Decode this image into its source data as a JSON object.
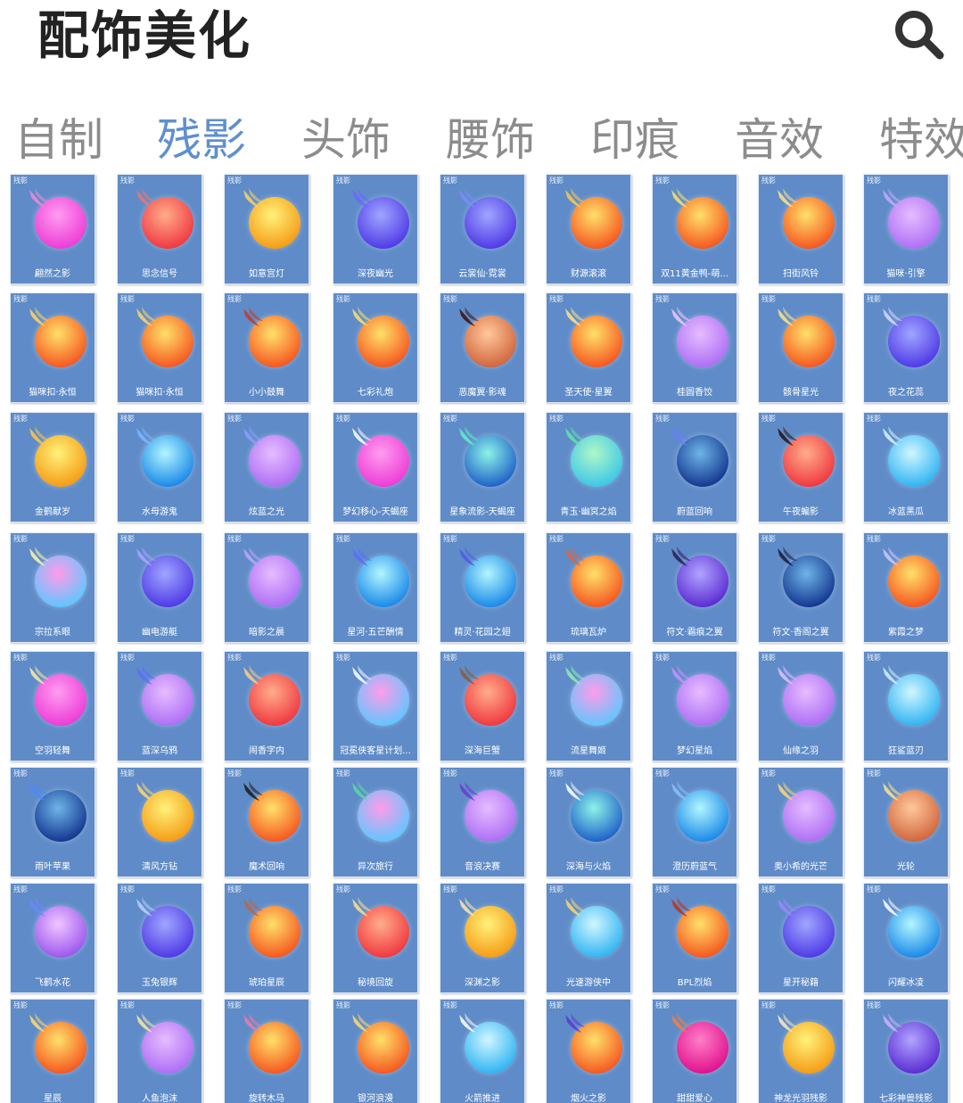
{
  "header": {
    "title": "配饰美化",
    "search_icon": "search-icon"
  },
  "tabs": [
    {
      "label": "自制",
      "active": false
    },
    {
      "label": "残影",
      "active": true
    },
    {
      "label": "头饰",
      "active": false
    },
    {
      "label": "腰饰",
      "active": false
    },
    {
      "label": "印痕",
      "active": false
    },
    {
      "label": "音效",
      "active": false
    },
    {
      "label": "特效",
      "active": false
    }
  ],
  "palette": {
    "pink": [
      "#ff9cf0",
      "#ec3bd6"
    ],
    "red": [
      "#ffad8a",
      "#f0363f"
    ],
    "orange": [
      "#ffe06a",
      "#f5551e"
    ],
    "yellow": [
      "#fff27a",
      "#f59a14"
    ],
    "blue": [
      "#a0a6ff",
      "#4e38e6"
    ],
    "violet": [
      "#f0c6ff",
      "#9b55ee"
    ],
    "lavender": [
      "#e6bcff",
      "#ad6ef4"
    ],
    "cyan": [
      "#b2f6ff",
      "#1887e8"
    ],
    "teal": [
      "#8cf3e8",
      "#1e5ec8"
    ],
    "navy": [
      "#6fb4e8",
      "#12358e"
    ],
    "mint": [
      "#aef8c6",
      "#3cc6e8"
    ],
    "sky": [
      "#d0f6ff",
      "#2eb3f2"
    ],
    "grad": [
      "#ff9cea",
      "#5ec6ff"
    ],
    "copper": [
      "#ffc89a",
      "#d0643c"
    ],
    "magenta": [
      "#ff7ec8",
      "#e0108c"
    ],
    "indigo": [
      "#b0a4ff",
      "#5a2ad2"
    ]
  },
  "cards": [
    {
      "tag": "残影",
      "name": "翩然之影",
      "orb": "pink",
      "deco": "#f08ad6"
    },
    {
      "tag": "残影",
      "name": "思念信号",
      "orb": "red",
      "deco": "#f07470"
    },
    {
      "tag": "残影",
      "name": "如意宫灯",
      "orb": "yellow",
      "deco": "#ffd166"
    },
    {
      "tag": "残影",
      "name": "深夜幽光",
      "orb": "blue",
      "deco": "#6a66ff"
    },
    {
      "tag": "残影",
      "name": "云裳仙·霓裳",
      "orb": "blue",
      "deco": "#7a8cff"
    },
    {
      "tag": "残影",
      "name": "财源滚滚",
      "orb": "orange",
      "deco": "#ffc84a"
    },
    {
      "tag": "残影",
      "name": "双11黄金鸭-萌...",
      "orb": "orange",
      "deco": "#ffe066"
    },
    {
      "tag": "残影",
      "name": "扫街风铃",
      "orb": "orange",
      "deco": "#ffe38a"
    },
    {
      "tag": "残影",
      "name": "猫咪·引擎",
      "orb": "lavender",
      "deco": "#c9a8ff"
    },
    {
      "tag": "残影",
      "name": "猫咪扣·永恒",
      "orb": "orange",
      "deco": "#ffd566"
    },
    {
      "tag": "残影",
      "name": "猫咪扣·永恒",
      "orb": "orange",
      "deco": "#ffd566"
    },
    {
      "tag": "残影",
      "name": "小小鼓舞",
      "orb": "orange",
      "deco": "#c0392b"
    },
    {
      "tag": "残影",
      "name": "七彩礼炮",
      "orb": "orange",
      "deco": "#ffdf6a"
    },
    {
      "tag": "残影",
      "name": "恶魔翼·影魂",
      "orb": "copper",
      "deco": "#3a1010"
    },
    {
      "tag": "残影",
      "name": "圣天使·星翼",
      "orb": "orange",
      "deco": "#ffe38a"
    },
    {
      "tag": "残影",
      "name": "桂圆香饺",
      "orb": "lavender",
      "deco": "#f2c8ff"
    },
    {
      "tag": "残影",
      "name": "骸骨星光",
      "orb": "orange",
      "deco": "#ffe38a"
    },
    {
      "tag": "残影",
      "name": "夜之花蕊",
      "orb": "blue",
      "deco": "#d8d8ff"
    },
    {
      "tag": "残影",
      "name": "金鹤献岁",
      "orb": "yellow",
      "deco": "#ffc84a"
    },
    {
      "tag": "残影",
      "name": "水母游鬼",
      "orb": "cyan",
      "deco": "#7ab8ff"
    },
    {
      "tag": "残影",
      "name": "炫蓝之光",
      "orb": "lavender",
      "deco": "#8e9cff"
    },
    {
      "tag": "残影",
      "name": "梦幻移心-天蝎座",
      "orb": "pink",
      "deco": "#ffffff"
    },
    {
      "tag": "残影",
      "name": "星象流影-天蝎座",
      "orb": "teal",
      "deco": "#5ff0c8"
    },
    {
      "tag": "残影",
      "name": "青玉·幽冥之焰",
      "orb": "mint",
      "deco": "#5fe8a8"
    },
    {
      "tag": "残影",
      "name": "蔚蓝回响",
      "orb": "navy",
      "deco": "#6a7cff"
    },
    {
      "tag": "残影",
      "name": "午夜蝙影",
      "orb": "red",
      "deco": "#2a1010"
    },
    {
      "tag": "残影",
      "name": "冰蓝黑瓜",
      "orb": "sky",
      "deco": "#d8f4ff"
    },
    {
      "tag": "残影",
      "name": "宗拉系眼",
      "orb": "grad",
      "deco": "#fff4b0"
    },
    {
      "tag": "残影",
      "name": "幽电游艇",
      "orb": "blue",
      "deco": "#b0a0ff"
    },
    {
      "tag": "残影",
      "name": "暗影之晨",
      "orb": "lavender",
      "deco": "#c0a4ff"
    },
    {
      "tag": "残影",
      "name": "星河·五芒酬情",
      "orb": "cyan",
      "deco": "#5a6cff"
    },
    {
      "tag": "残影",
      "name": "精灵·花园之翅",
      "orb": "cyan",
      "deco": "#4a5ce8"
    },
    {
      "tag": "残影",
      "name": "琉璃瓦炉",
      "orb": "orange",
      "deco": "#e0643c"
    },
    {
      "tag": "残影",
      "name": "符文·霜痕之翼",
      "orb": "indigo",
      "deco": "#2a1a5a"
    },
    {
      "tag": "残影",
      "name": "符文·香阁之翼",
      "orb": "navy",
      "deco": "#1a1a3a"
    },
    {
      "tag": "残影",
      "name": "紫霞之梦",
      "orb": "orange",
      "deco": "#d0c8ff"
    },
    {
      "tag": "残影",
      "name": "空羽轻舞",
      "orb": "pink",
      "deco": "#ffe9a0"
    },
    {
      "tag": "残影",
      "name": "蓝深乌鸦",
      "orb": "lavender",
      "deco": "#5a6cff"
    },
    {
      "tag": "残影",
      "name": "闹香字内",
      "orb": "red",
      "deco": "#ffcc80"
    },
    {
      "tag": "残影",
      "name": "冠冕侠客星计划...",
      "orb": "grad",
      "deco": "#ffffff"
    },
    {
      "tag": "残影",
      "name": "深海巨蟹",
      "orb": "red",
      "deco": "#8a5a3a"
    },
    {
      "tag": "残影",
      "name": "流星舞姬",
      "orb": "grad",
      "deco": "#8ef0b0"
    },
    {
      "tag": "残影",
      "name": "梦幻星焰",
      "orb": "lavender",
      "deco": "#c890ff"
    },
    {
      "tag": "残影",
      "name": "仙缘之羽",
      "orb": "lavender",
      "deco": "#e0c0ff"
    },
    {
      "tag": "残影",
      "name": "狂鲨蓝刃",
      "orb": "sky",
      "deco": "#d0f0ff"
    },
    {
      "tag": "残影",
      "name": "雨叶苹果",
      "orb": "navy",
      "deco": "#4a88ff"
    },
    {
      "tag": "残影",
      "name": "清风方钻",
      "orb": "yellow",
      "deco": "#ffd870"
    },
    {
      "tag": "残影",
      "name": "魔术回响",
      "orb": "orange",
      "deco": "#1a1a1a"
    },
    {
      "tag": "残影",
      "name": "异次旅行",
      "orb": "grad",
      "deco": "#5ad8a0"
    },
    {
      "tag": "残影",
      "name": "音浪决赛",
      "orb": "lavender",
      "deco": "#6a3ad0"
    },
    {
      "tag": "残影",
      "name": "深海与火焰",
      "orb": "teal",
      "deco": "#ffffff"
    },
    {
      "tag": "残影",
      "name": "澄历蔚蓝气",
      "orb": "cyan",
      "deco": "#8ac0ff"
    },
    {
      "tag": "残影",
      "name": "奥小希的光芒",
      "orb": "lavender",
      "deco": "#ffd870"
    },
    {
      "tag": "残影",
      "name": "光轮",
      "orb": "copper",
      "deco": "#ffe38a"
    },
    {
      "tag": "残影",
      "name": "飞鹤水花",
      "orb": "violet",
      "deco": "#6a88ff"
    },
    {
      "tag": "残影",
      "name": "玉兔银辉",
      "orb": "blue",
      "deco": "#b8d0ff"
    },
    {
      "tag": "残影",
      "name": "琥珀星辰",
      "orb": "orange",
      "deco": "#c0643c"
    },
    {
      "tag": "残影",
      "name": "秘境回旋",
      "orb": "red",
      "deco": "#ffe08a"
    },
    {
      "tag": "残影",
      "name": "深渊之影",
      "orb": "yellow",
      "deco": "#ffe8b0"
    },
    {
      "tag": "残影",
      "name": "光速游侠中",
      "orb": "sky",
      "deco": "#ffd870"
    },
    {
      "tag": "残影",
      "name": "BPL烈焰",
      "orb": "orange",
      "deco": "#c0301c"
    },
    {
      "tag": "残影",
      "name": "星开秘籍",
      "orb": "blue",
      "deco": "#9a88ff"
    },
    {
      "tag": "残影",
      "name": "闪耀冰凌",
      "orb": "cyan",
      "deco": "#ffffff"
    },
    {
      "tag": "残影",
      "name": "星辰",
      "orb": "orange",
      "deco": "#ffd870"
    },
    {
      "tag": "残影",
      "name": "人鱼泡沫",
      "orb": "lavender",
      "deco": "#ffe9a0"
    },
    {
      "tag": "残影",
      "name": "旋转木马",
      "orb": "orange",
      "deco": "#f07aa8"
    },
    {
      "tag": "残影",
      "name": "银河浪漫",
      "orb": "orange",
      "deco": "#ffd870"
    },
    {
      "tag": "残影",
      "name": "火箭推进",
      "orb": "sky",
      "deco": "#ffffff"
    },
    {
      "tag": "残影",
      "name": "烟火之影",
      "orb": "orange",
      "deco": "#5a3ad0"
    },
    {
      "tag": "残影",
      "name": "甜甜爱心",
      "orb": "magenta",
      "deco": "#ff7a3c"
    },
    {
      "tag": "残影",
      "name": "神龙光羽残影",
      "orb": "yellow",
      "deco": "#ffe9c0"
    },
    {
      "tag": "残影",
      "name": "七彩神兽残影",
      "orb": "indigo",
      "deco": "#d0b0ff"
    }
  ]
}
